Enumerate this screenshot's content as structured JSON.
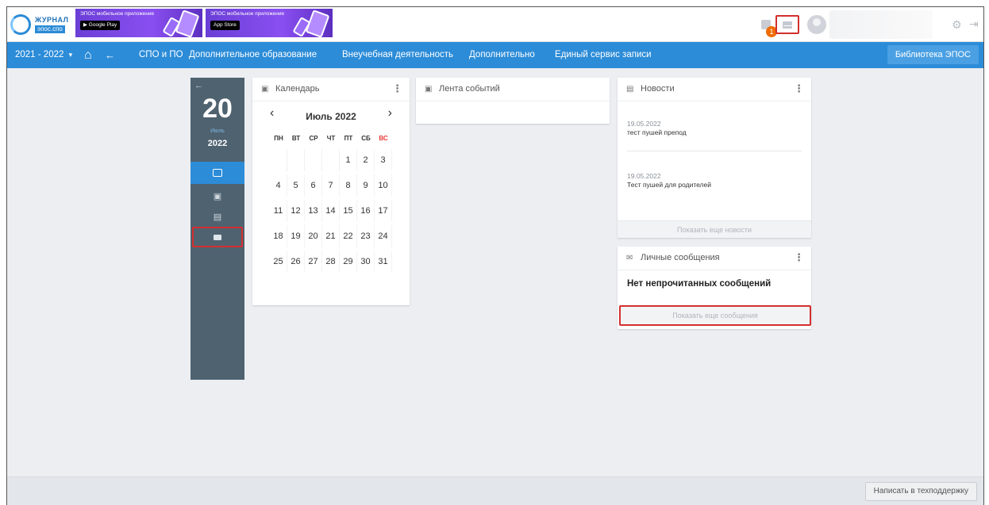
{
  "logo": {
    "line1": "ЖУРНАЛ",
    "line2": "эпос.спо"
  },
  "banners": [
    {
      "title": "ЭПОС мобильное приложение",
      "store": "▶ Google Play"
    },
    {
      "title": "ЭПОС мобильное приложение",
      "store": " App Store"
    }
  ],
  "topbar": {
    "notification_count": "1",
    "gear_icon": "⚙",
    "exit_icon": "⇥"
  },
  "nav": {
    "year": "2021 - 2022",
    "year_caret": "▾",
    "home_icon": "⌂",
    "back_icon": "←",
    "items": [
      "СПО и ПО",
      "Дополнительное образование",
      "Внеучебная деятельность",
      "Дополнительно",
      "Единый сервис записи"
    ],
    "library": "Библиотека ЭПОС"
  },
  "date_panel": {
    "back_icon": "←",
    "day": "20",
    "month": "Июль",
    "year": "2022"
  },
  "calendar": {
    "icon": "▣",
    "title": "Календарь",
    "menu": "⋮",
    "month_label": "Июль 2022",
    "prev": "‹",
    "next": "›",
    "weekdays": [
      "ПН",
      "ВТ",
      "СР",
      "ЧТ",
      "ПТ",
      "СБ",
      "ВС"
    ],
    "weeks": [
      [
        "",
        "",
        "",
        "",
        "1",
        "2",
        "3"
      ],
      [
        "4",
        "5",
        "6",
        "7",
        "8",
        "9",
        "10"
      ],
      [
        "11",
        "12",
        "13",
        "14",
        "15",
        "16",
        "17"
      ],
      [
        "18",
        "19",
        "20",
        "21",
        "22",
        "23",
        "24"
      ],
      [
        "25",
        "26",
        "27",
        "28",
        "29",
        "30",
        "31"
      ]
    ],
    "sunday_color": "#e53935"
  },
  "events": {
    "icon": "▣",
    "title": "Лента событий"
  },
  "news": {
    "icon": "▤",
    "title": "Новости",
    "menu": "⋮",
    "items": [
      {
        "date": "19.05.2022",
        "text": "тест пушей препод"
      },
      {
        "date": "19.05.2022",
        "text": "Тест пушей для родителей"
      }
    ],
    "more": "Показать еще новости"
  },
  "messages": {
    "icon": "✉",
    "title": "Личные сообщения",
    "menu": "⋮",
    "empty": "Нет непрочитанных сообщений",
    "more": "Показать еще сообщения"
  },
  "footer": {
    "support": "Написать в техподдержку"
  },
  "colors": {
    "primary": "#2c8cd8",
    "panel": "#4f6270",
    "highlight": "#d32f2f",
    "badge": "#ef6c00"
  }
}
